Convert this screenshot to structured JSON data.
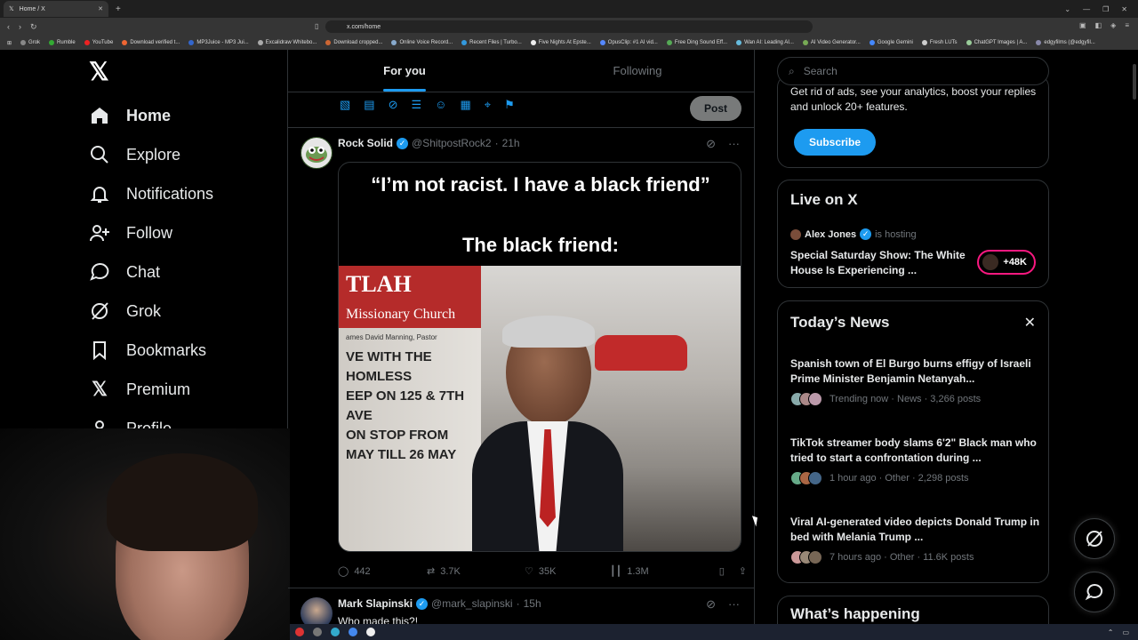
{
  "browser": {
    "tab_title": "Home / X",
    "url": "x.com/home",
    "bookmarks": [
      "Grok",
      "Rumble",
      "YouTube",
      "Download verified t...",
      "MP3Juice - MP3 Jui...",
      "Excalidraw Whitebo...",
      "Download cropped...",
      "Online Voice Record...",
      "Recent Files | Turbo...",
      "Five Nights At Epste...",
      "OpusClip: #1 AI vid...",
      "Free Ding Sound Eff...",
      "Wan AI: Leading AI...",
      "AI Video Generator...",
      "Google Gemini",
      "Fresh LUTs",
      "ChatGPT Images | A...",
      "edgyfilms (@edgyfil..."
    ]
  },
  "sidebar": {
    "items": [
      {
        "label": "Home",
        "icon": "home-icon"
      },
      {
        "label": "Explore",
        "icon": "search-icon"
      },
      {
        "label": "Notifications",
        "icon": "bell-icon"
      },
      {
        "label": "Follow",
        "icon": "follow-icon"
      },
      {
        "label": "Chat",
        "icon": "chat-icon"
      },
      {
        "label": "Grok",
        "icon": "grok-icon"
      },
      {
        "label": "Bookmarks",
        "icon": "bookmark-icon"
      },
      {
        "label": "Premium",
        "icon": "x-icon"
      },
      {
        "label": "Profile",
        "icon": "profile-icon"
      }
    ]
  },
  "timeline": {
    "tabs": [
      "For you",
      "Following"
    ],
    "post_label": "Post",
    "tweets": [
      {
        "name": "Rock Solid",
        "handle": "@ShitpostRock2",
        "time": "21h",
        "meme_line1": "“I’m not racist. I have a black friend”",
        "meme_line2": "The black friend:",
        "sign_top": "TLAH",
        "sign_line": "Missionary Church",
        "sign_sub": "ames David Manning, Pastor",
        "sign_board": [
          "VE WITH THE HOMLESS",
          "EEP ON 125 & 7TH AVE",
          "ON  STOP FROM",
          "MAY TILL 26 MAY"
        ],
        "replies": "442",
        "reposts": "3.7K",
        "likes": "35K",
        "views": "1.3M"
      },
      {
        "name": "Mark Slapinski",
        "handle": "@mark_slapinski",
        "time": "15h",
        "text": "Who made this?!"
      }
    ]
  },
  "right": {
    "search_placeholder": "Search",
    "premium_text": "Get rid of ads, see your analytics, boost your replies and unlock 20+ features.",
    "subscribe_label": "Subscribe",
    "live_title": "Live on X",
    "live_host": "Alex Jones",
    "live_hosting": "is hosting",
    "live_stream": "Special Saturday Show: The White House Is Experiencing ...",
    "live_count": "+48K",
    "news_title": "Today’s News",
    "news": [
      {
        "title": "Spanish town of El Burgo burns effigy of Israeli Prime Minister Benjamin Netanyah...",
        "meta": "Trending now · News · 3,266 posts"
      },
      {
        "title": "TikTok streamer body slams 6'2\" Black man who tried to start a confrontation during ...",
        "meta": "1 hour ago · Other · 2,298 posts"
      },
      {
        "title": "Viral AI-generated video depicts Donald Trump in bed with Melania Trump ...",
        "meta": "7 hours ago · Other · 11.6K posts"
      }
    ],
    "happening_title": "What’s happening"
  },
  "colors": {
    "accent": "#1d9bf0",
    "live": "#f91880",
    "border": "#2f3336",
    "muted": "#71767b"
  }
}
